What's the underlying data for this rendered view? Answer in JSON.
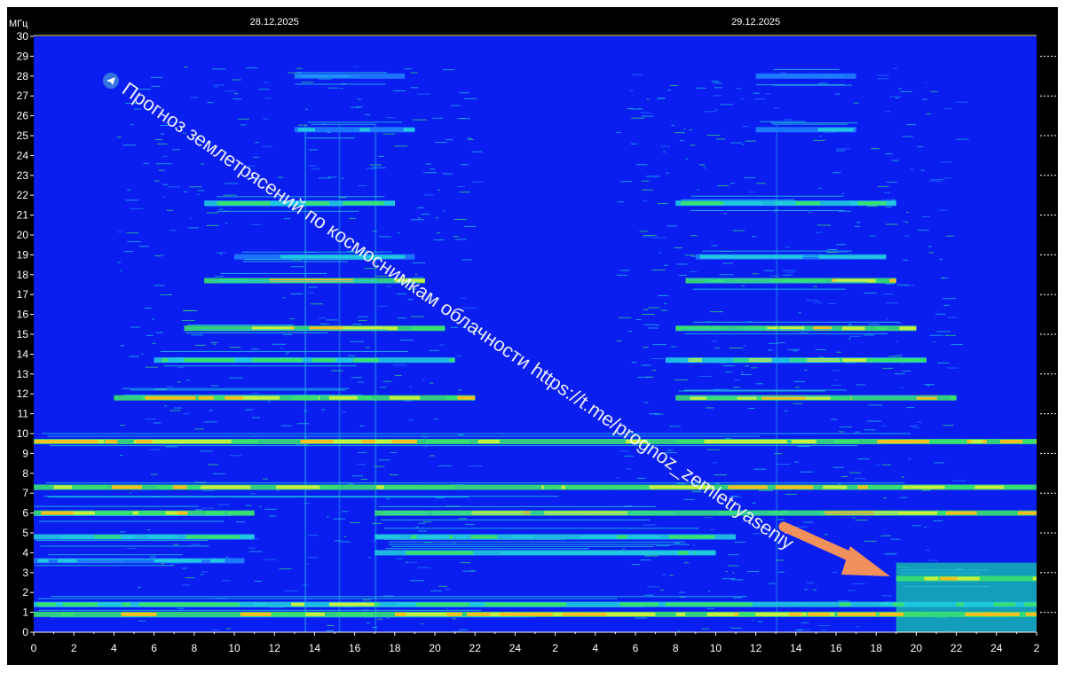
{
  "chart_data": {
    "type": "heatmap",
    "title": "",
    "ylabel": "МГц",
    "xlabel": "",
    "ylim": [
      0,
      30
    ],
    "yticks": [
      0,
      1,
      2,
      3,
      4,
      5,
      6,
      7,
      8,
      9,
      10,
      11,
      12,
      13,
      14,
      15,
      16,
      17,
      18,
      19,
      20,
      21,
      22,
      23,
      24,
      25,
      26,
      27,
      28,
      29,
      30
    ],
    "xticks": [
      "0",
      "2",
      "4",
      "6",
      "8",
      "10",
      "12",
      "14",
      "16",
      "18",
      "20",
      "22",
      "24",
      "2",
      "4",
      "6",
      "8",
      "10",
      "12",
      "14",
      "16",
      "18",
      "20",
      "22",
      "24",
      "2"
    ],
    "date_labels": [
      {
        "label": "28.12.2025",
        "hour": 12
      },
      {
        "label": "29.12.2025",
        "hour": 36
      }
    ],
    "x_range_hours": [
      0,
      50
    ],
    "background_color": "#0a1ef0",
    "bands": [
      {
        "mhz": 0.9,
        "start": 0,
        "end": 50,
        "intensity": 0.9
      },
      {
        "mhz": 1.4,
        "start": 0,
        "end": 50,
        "intensity": 0.6
      },
      {
        "mhz": 2.7,
        "start": 43,
        "end": 50,
        "intensity": 0.8
      },
      {
        "mhz": 3.6,
        "start": 0,
        "end": 10.5,
        "intensity": 0.35
      },
      {
        "mhz": 4.0,
        "start": 17,
        "end": 34,
        "intensity": 0.45
      },
      {
        "mhz": 4.8,
        "start": 0,
        "end": 11,
        "intensity": 0.5
      },
      {
        "mhz": 4.8,
        "start": 17,
        "end": 35,
        "intensity": 0.5
      },
      {
        "mhz": 6.0,
        "start": 0,
        "end": 11,
        "intensity": 0.8
      },
      {
        "mhz": 6.0,
        "start": 17,
        "end": 50,
        "intensity": 0.8
      },
      {
        "mhz": 7.3,
        "start": 0,
        "end": 50,
        "intensity": 0.75
      },
      {
        "mhz": 9.6,
        "start": 0,
        "end": 50,
        "intensity": 0.85
      },
      {
        "mhz": 11.8,
        "start": 4,
        "end": 22,
        "intensity": 0.8
      },
      {
        "mhz": 11.8,
        "start": 32,
        "end": 46,
        "intensity": 0.8
      },
      {
        "mhz": 13.7,
        "start": 6,
        "end": 21,
        "intensity": 0.65
      },
      {
        "mhz": 13.7,
        "start": 31.5,
        "end": 44.5,
        "intensity": 0.65
      },
      {
        "mhz": 15.3,
        "start": 7.5,
        "end": 20.5,
        "intensity": 0.75
      },
      {
        "mhz": 15.3,
        "start": 32,
        "end": 44,
        "intensity": 0.75
      },
      {
        "mhz": 17.7,
        "start": 8.5,
        "end": 19.5,
        "intensity": 0.8
      },
      {
        "mhz": 17.7,
        "start": 32.5,
        "end": 43,
        "intensity": 0.8
      },
      {
        "mhz": 18.9,
        "start": 10,
        "end": 19,
        "intensity": 0.4
      },
      {
        "mhz": 18.9,
        "start": 33,
        "end": 42.5,
        "intensity": 0.4
      },
      {
        "mhz": 21.6,
        "start": 8.5,
        "end": 18,
        "intensity": 0.6
      },
      {
        "mhz": 21.6,
        "start": 32,
        "end": 43,
        "intensity": 0.6
      },
      {
        "mhz": 25.3,
        "start": 13,
        "end": 19,
        "intensity": 0.3
      },
      {
        "mhz": 25.3,
        "start": 36,
        "end": 41,
        "intensity": 0.3
      },
      {
        "mhz": 28.0,
        "start": 13,
        "end": 18.5,
        "intensity": 0.25
      },
      {
        "mhz": 28.0,
        "start": 36,
        "end": 41,
        "intensity": 0.25
      }
    ],
    "vertical_lines": [
      {
        "hour": 13.5,
        "intensity": 0.45
      },
      {
        "hour": 15.2,
        "intensity": 0.35
      },
      {
        "hour": 17.0,
        "intensity": 0.4
      },
      {
        "hour": 37.0,
        "intensity": 0.35
      }
    ],
    "highlight_region": {
      "x_start": 43,
      "x_end": 50,
      "y_start": 0,
      "y_end": 3.5,
      "color": "#18c8a8"
    }
  },
  "watermark": {
    "text": "Прогноз землетрясений по космоснимкам облачности  https://t.me/prognoz_zemletryaseniy",
    "icon": "telegram-icon"
  },
  "arrow": {
    "color": "#f0905a"
  }
}
